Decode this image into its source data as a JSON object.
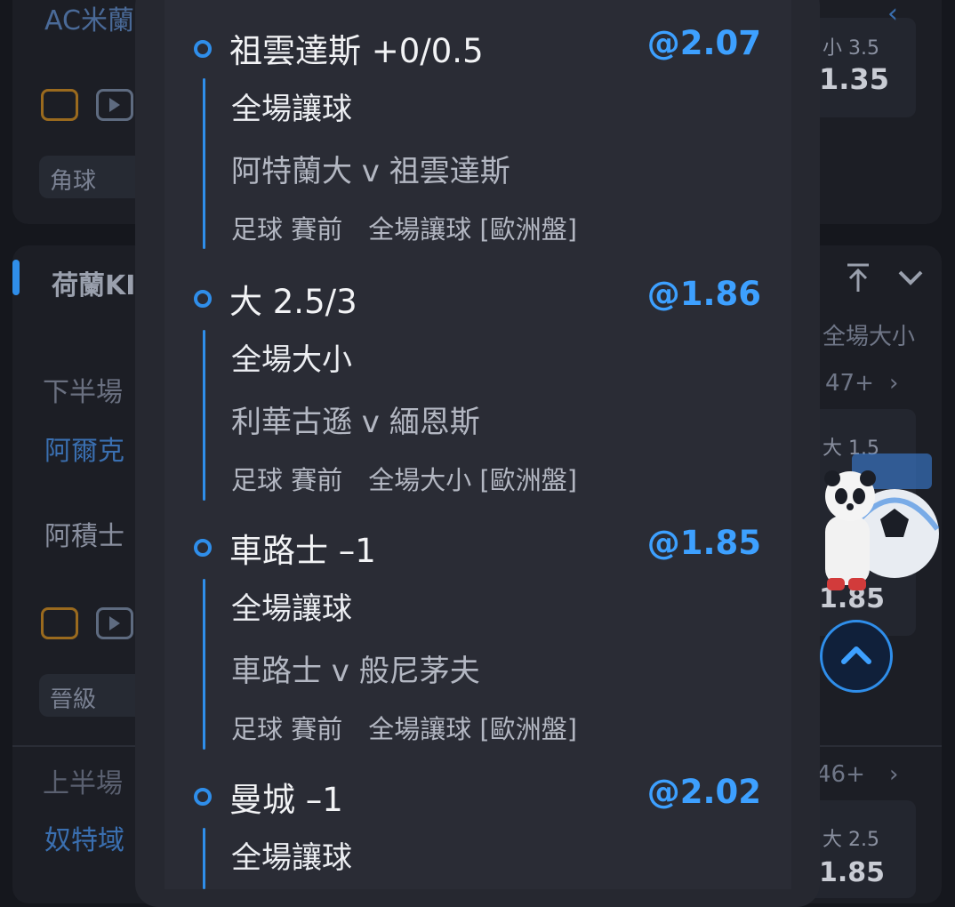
{
  "background": {
    "card1": {
      "team_top": "AC米蘭",
      "tag": "角球",
      "ou_label": "小 3.5",
      "ou_odds": "1.35"
    },
    "card2": {
      "league": "荷蘭KI",
      "col_header": "全場大小",
      "row1_period": "下半場",
      "row1_more": "47+",
      "row1_team_a": "阿爾克",
      "row1_team_b": "阿積士",
      "row1_ou": "大 1.5",
      "row1_ou_odds": "1.85",
      "tag": "晉級",
      "row2_period": "上半場",
      "row2_more": "46+",
      "row2_team_a": "奴特域",
      "row2_ou": "大 2.5",
      "row2_ou_odds": "1.85"
    },
    "colors": {
      "accent": "#2f8eea",
      "panel": "#2a2c35",
      "odds": "#3da0ff"
    }
  },
  "bets": [
    {
      "selection": "祖雲達斯 +0/0.5",
      "odds": "@2.07",
      "market": "全場讓球",
      "match": "阿特蘭大 v 祖雲達斯",
      "info": "足球 賽前　全場讓球 [歐洲盤]"
    },
    {
      "selection": "大 2.5/3",
      "odds": "@1.86",
      "market": "全場大小",
      "match": "利華古遜 v 緬恩斯",
      "info": "足球 賽前　全場大小 [歐洲盤]"
    },
    {
      "selection": "車路士 –1",
      "odds": "@1.85",
      "market": "全場讓球",
      "match": "車路士 v 般尼茅夫",
      "info": "足球 賽前　全場讓球 [歐洲盤]"
    },
    {
      "selection": "曼城 –1",
      "odds": "@2.02",
      "market": "全場讓球"
    }
  ],
  "icons": {
    "field": "soccer-field-icon",
    "video": "video-play-icon",
    "pin_top": "pin-to-top-icon",
    "collapse": "chevron-down-icon",
    "scroll_top": "chevron-up-icon",
    "mascot": "panda-mascot-icon"
  }
}
